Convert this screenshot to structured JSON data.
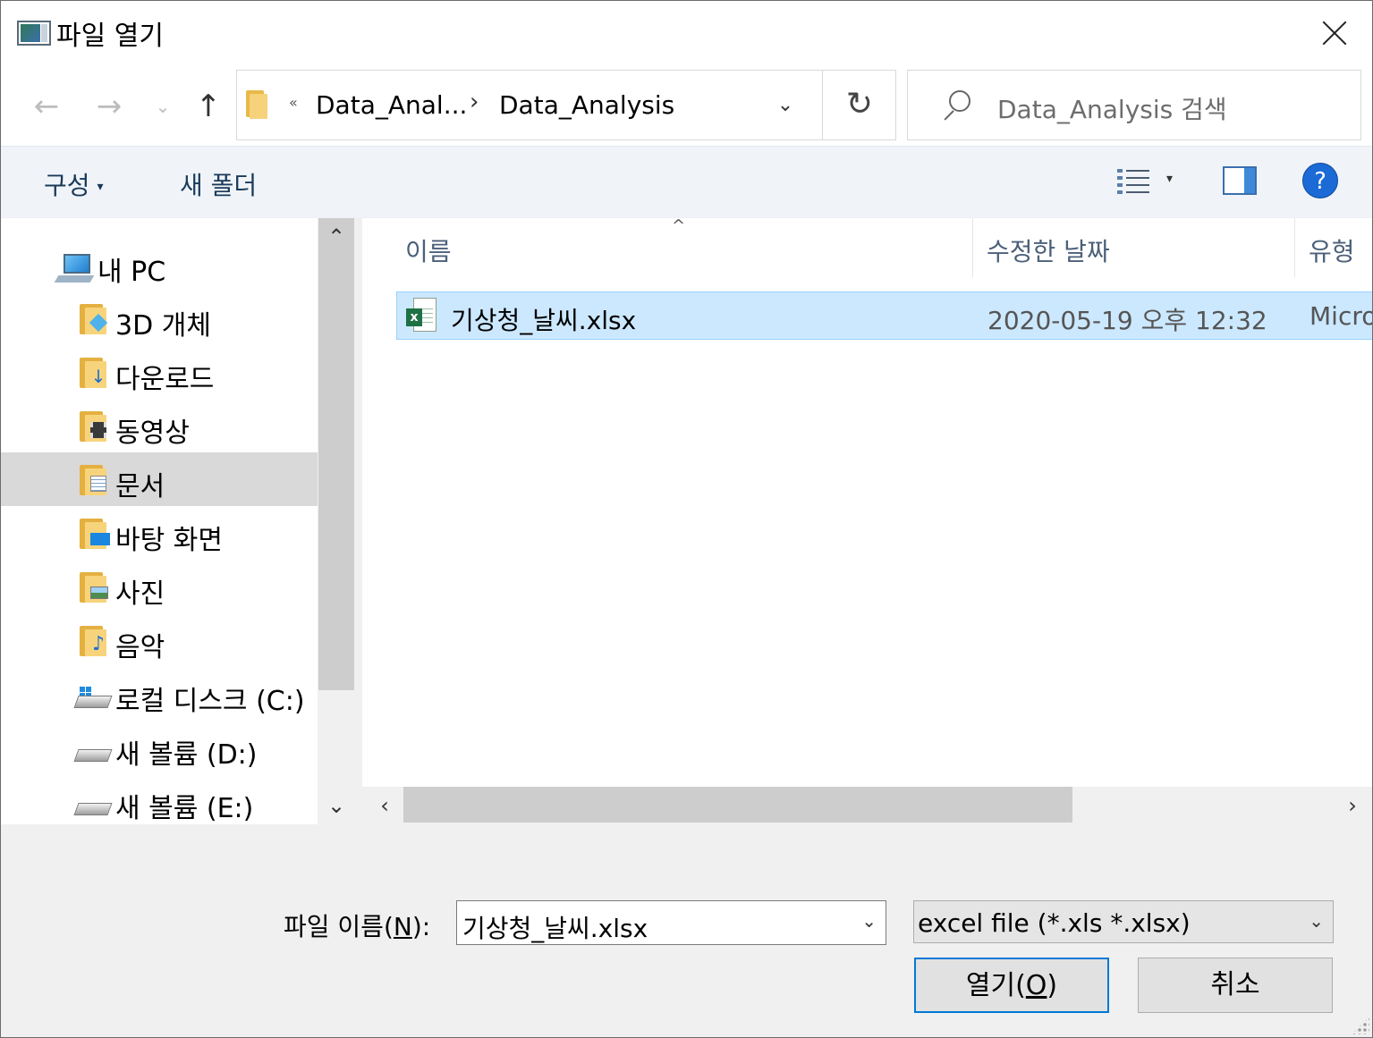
{
  "window": {
    "title": "파일 열기",
    "icon": "dialog-app-icon",
    "close_label": "close"
  },
  "navigation": {
    "back_icon": "←",
    "forward_icon": "→",
    "recent_icon": "⌄",
    "up_icon": "↑"
  },
  "address": {
    "overflow": "«",
    "crumbs": [
      "Data_Anal...",
      "Data_Analysis"
    ],
    "separator": "›",
    "dropdown_icon": "⌄",
    "refresh_icon": "↻"
  },
  "search": {
    "placeholder": "Data_Analysis 검색"
  },
  "command_bar": {
    "organize": "구성",
    "organize_caret": "▾",
    "new_folder": "새 폴더",
    "view_caret": "▾",
    "help": "?"
  },
  "nav_pane": {
    "items": [
      {
        "label": "내 PC",
        "icon": "this-pc-icon"
      },
      {
        "label": "3D 개체",
        "icon": "3d-objects-folder-icon"
      },
      {
        "label": "다운로드",
        "icon": "downloads-folder-icon"
      },
      {
        "label": "동영상",
        "icon": "videos-folder-icon"
      },
      {
        "label": "문서",
        "icon": "documents-folder-icon",
        "selected": true
      },
      {
        "label": "바탕 화면",
        "icon": "desktop-folder-icon"
      },
      {
        "label": "사진",
        "icon": "pictures-folder-icon"
      },
      {
        "label": "음악",
        "icon": "music-folder-icon"
      },
      {
        "label": "로컬 디스크 (C:)",
        "icon": "local-disk-icon"
      },
      {
        "label": "새 볼륨 (D:)",
        "icon": "drive-icon"
      },
      {
        "label": "새 볼륨 (E:)",
        "icon": "drive-icon"
      }
    ],
    "scroll_up": "⌃",
    "scroll_down": "⌄"
  },
  "file_list": {
    "columns": [
      "이름",
      "수정한 날짜",
      "유형"
    ],
    "sort_arrow": "^",
    "files": [
      {
        "name": "기상청_날씨.xlsx",
        "date": "2020-05-19 오후 12:32",
        "type": "Micro",
        "icon": "excel-file-icon",
        "selected": true
      }
    ],
    "scroll_left": "‹",
    "scroll_right": "›"
  },
  "footer": {
    "filename_label_prefix": "파일 이름(",
    "filename_label_hotkey": "N",
    "filename_label_suffix": "):",
    "filename_value": "기상청_날씨.xlsx",
    "filetype_value": "excel file (*.xls *.xlsx)",
    "chevron": "⌄",
    "open_prefix": "열기(",
    "open_hotkey": "O",
    "open_suffix": ")",
    "cancel": "취소"
  },
  "colors": {
    "selection_bg": "#cce8ff",
    "selection_border": "#99d1ff",
    "accent": "#0078d7",
    "nav_selected": "#d9d9d9"
  }
}
